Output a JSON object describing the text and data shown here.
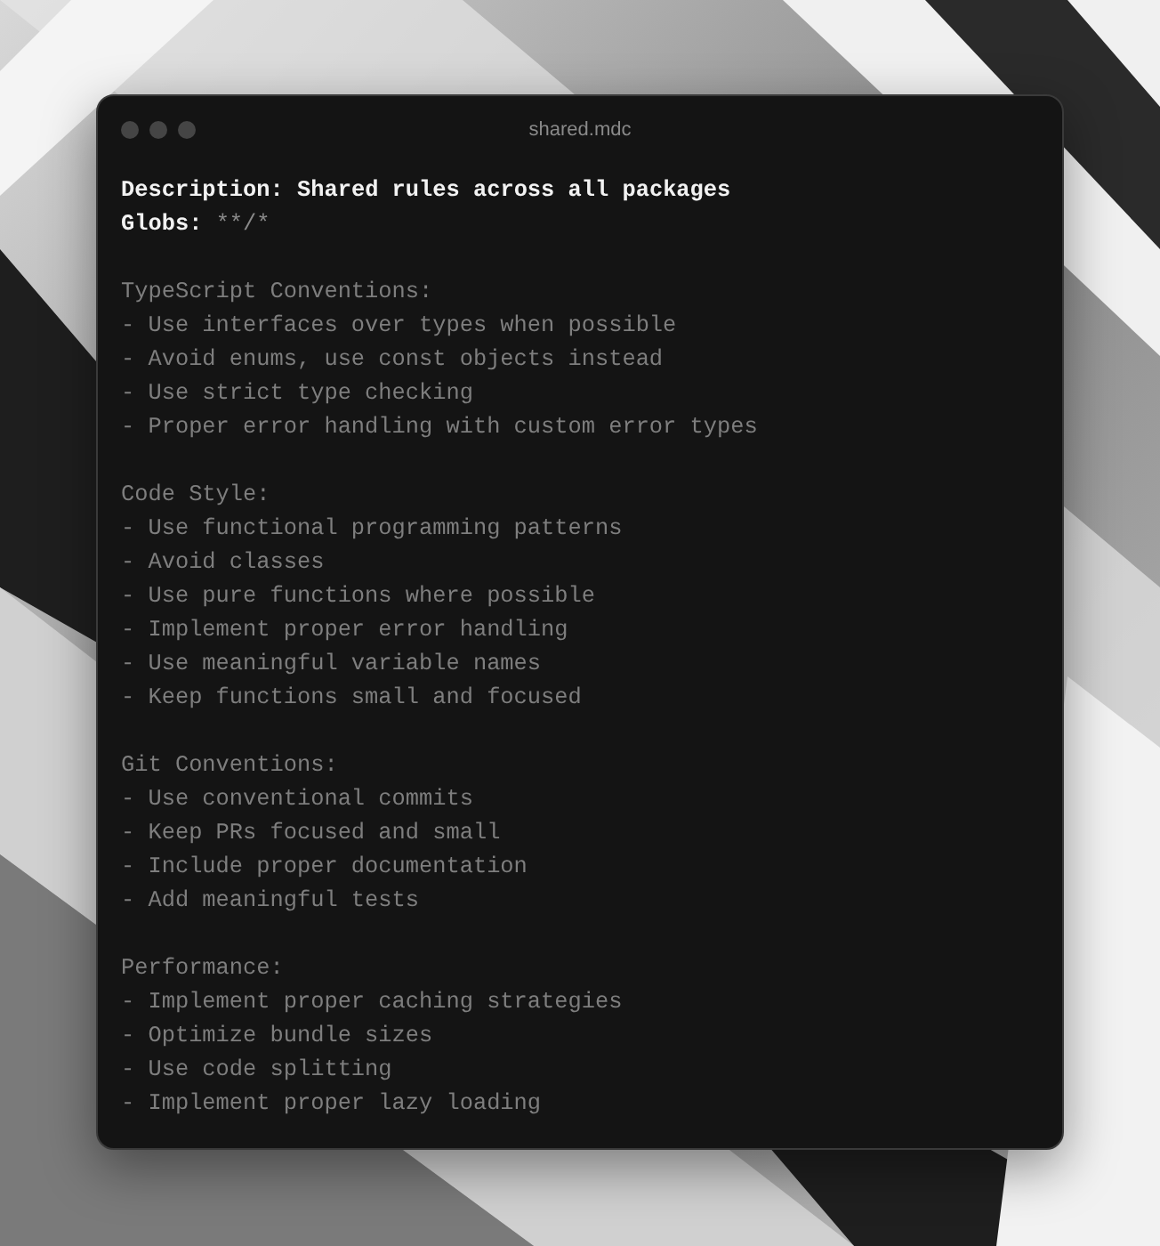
{
  "window": {
    "title": "shared.mdc"
  },
  "header": [
    {
      "label": "Description:",
      "value": "Shared rules across all packages",
      "highlighted": true
    },
    {
      "label": "Globs:",
      "value": "**/*",
      "highlighted": false
    }
  ],
  "sections": [
    {
      "heading": "TypeScript Conventions:",
      "items": [
        "- Use interfaces over types when possible",
        "- Avoid enums, use const objects instead",
        "- Use strict type checking",
        "- Proper error handling with custom error types"
      ]
    },
    {
      "heading": "Code Style:",
      "items": [
        "- Use functional programming patterns",
        "- Avoid classes",
        "- Use pure functions where possible",
        "- Implement proper error handling",
        "- Use meaningful variable names",
        "- Keep functions small and focused"
      ]
    },
    {
      "heading": "Git Conventions:",
      "items": [
        "- Use conventional commits",
        "- Keep PRs focused and small",
        "- Include proper documentation",
        "- Add meaningful tests"
      ]
    },
    {
      "heading": "Performance:",
      "items": [
        "- Implement proper caching strategies",
        "- Optimize bundle sizes",
        "- Use code splitting",
        "- Implement proper lazy loading"
      ]
    }
  ]
}
